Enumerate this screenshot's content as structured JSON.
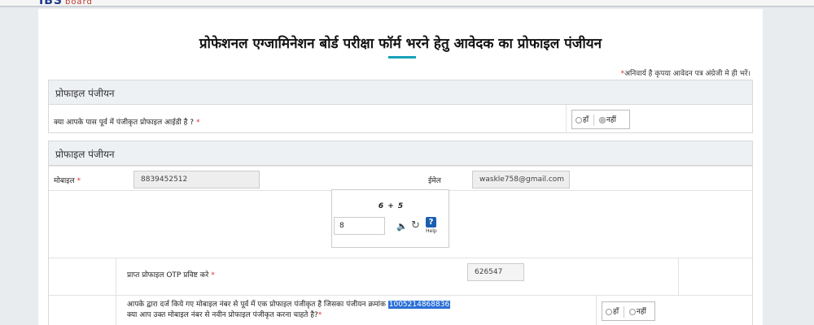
{
  "header": {
    "logo_text": "IBS",
    "logo_sub": "board"
  },
  "page": {
    "title": "प्रोफेशनल एग्जामिनेशन बोर्ड परीक्षा फॉर्म भरने हेतु आवेदक का प्रोफाइल पंजीयन",
    "note_star": "*",
    "note_text": "अनिवार्य है कृपया आवेदन पत्र अंग्रेजी मे ही भरें।"
  },
  "section1": {
    "heading": "प्रोफाइल पंजीयन",
    "question": "क्या आपके पास पूर्व में पंजीकृत प्रोफाइल आईडी है ?",
    "required": "*",
    "yes_label": "हाँ",
    "no_label": "नहीं",
    "selected": "no"
  },
  "section2": {
    "heading": "प्रोफाइल पंजीयन",
    "mobile_label": "मोबाइल",
    "mobile_required": "*",
    "mobile_value": "8839452512",
    "email_label": "ईमेल",
    "email_value": "waskle758@gmail.com",
    "captcha": {
      "question": "6 + 5",
      "answer": "8",
      "speaker_icon": "speaker-icon",
      "refresh_icon": "refresh-icon",
      "help_icon_text": "?",
      "help_label": "Help"
    },
    "otp_label": "प्राप्त प्रोफाइल OTP प्रविष्ट करे",
    "otp_required": "*",
    "otp_value": "626547",
    "existing_text_prefix": "आपके द्वारा दर्ज किये गए मोबाइल नंबर से पूर्व में एक प्रोफाइल पंजीकृत है जिसका पंजीयन क्रमांक",
    "existing_reg_no": "1005214868836",
    "existing_question": "क्या आप उक्त मोबाइल नंबर से नवीन प्रोफाइल पंजीकृत करना चाहते है?",
    "existing_required": "*",
    "yes_label": "हाँ",
    "no_label": "नहीं"
  }
}
